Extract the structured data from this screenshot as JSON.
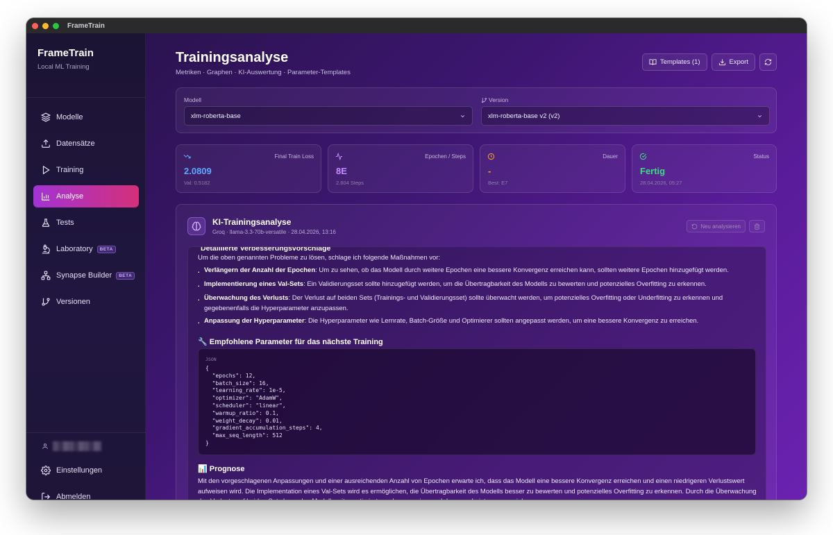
{
  "window": {
    "title": "FrameTrain"
  },
  "sidebar": {
    "brand": "FrameTrain",
    "subtitle": "Local ML Training",
    "items": [
      {
        "label": "Modelle"
      },
      {
        "label": "Datensätze"
      },
      {
        "label": "Training"
      },
      {
        "label": "Analyse",
        "active": true
      },
      {
        "label": "Tests"
      },
      {
        "label": "Laboratory",
        "badge": "BETA"
      },
      {
        "label": "Synapse Builder",
        "badge": "BETA"
      },
      {
        "label": "Versionen"
      }
    ],
    "settings_label": "Einstellungen",
    "logout_label": "Abmelden"
  },
  "header": {
    "title": "Trainingsanalyse",
    "subtitle": "Metriken · Graphen · KI-Auswertung · Parameter-Templates",
    "templates_label": "Templates (1)",
    "export_label": "Export"
  },
  "selectors": {
    "model_label": "Modell",
    "model_value": "xlm-roberta-base",
    "version_label": "Version",
    "version_value": "xlm-roberta-base v2 (v2)"
  },
  "stats": [
    {
      "label": "Final Train Loss",
      "value": "2.0809",
      "sub": "Val: 0.5182",
      "color": "#5fa8ff"
    },
    {
      "label": "Epochen / Steps",
      "value": "8E",
      "sub": "2.604 Steps",
      "color": "#c58cff"
    },
    {
      "label": "Dauer",
      "value": "-",
      "sub": "Best: E7",
      "color": "#f5a524"
    },
    {
      "label": "Status",
      "value": "Fertig",
      "sub": "28.04.2026, 05:27",
      "color": "#3ddc84"
    }
  ],
  "ai": {
    "title": "KI-Trainingsanalyse",
    "meta": "Groq · llama-3.3-70b-versatile · 28.04.2026, 13:16",
    "reanalyze_label": "Neu analysieren",
    "cut_heading": "Detaillierte Verbesserungsvorschläge",
    "intro": "Um die oben genannten Probleme zu lösen, schlage ich folgende Maßnahmen vor:",
    "bullets": [
      {
        "bold": "Verlängern der Anzahl der Epochen",
        "text": ": Um zu sehen, ob das Modell durch weitere Epochen eine bessere Konvergenz erreichen kann, sollten weitere Epochen hinzugefügt werden."
      },
      {
        "bold": "Implementierung eines Val-Sets",
        "text": ": Ein Validierungsset sollte hinzugefügt werden, um die Übertragbarkeit des Modells zu bewerten und potenzielles Overfitting zu erkennen."
      },
      {
        "bold": "Überwachung des Verlusts",
        "text": ": Der Verlust auf beiden Sets (Trainings- und Validierungsset) sollte überwacht werden, um potenzielles Overfitting oder Underfitting zu erkennen und gegebenenfalls die Hyperparameter anzupassen."
      },
      {
        "bold": "Anpassung der Hyperparameter",
        "text": ": Die Hyperparameter wie Lernrate, Batch-Größe und Optimierer sollten angepasst werden, um eine bessere Konvergenz zu erreichen."
      }
    ],
    "params_heading": "🔧 Empfohlene Parameter für das nächste Training",
    "code_label": "JSON",
    "code": "{\n  \"epochs\": 12,\n  \"batch_size\": 16,\n  \"learning_rate\": 1e-5,\n  \"optimizer\": \"AdamW\",\n  \"scheduler\": \"linear\",\n  \"warmup_ratio\": 0.1,\n  \"weight_decay\": 0.01,\n  \"gradient_accumulation_steps\": 4,\n  \"max_seq_length\": 512\n}",
    "forecast_heading": "📊 Prognose",
    "forecast_text": "Mit den vorgeschlagenen Anpassungen und einer ausreichenden Anzahl von Epochen erwarte ich, dass das Modell eine bessere Konvergenz erreichen und einen niedrigeren Verlustswert aufweisen wird. Die Implementation eines Val-Sets wird es ermöglichen, die Übertragbarkeit des Modells besser zu bewerten und potenzielles Overfitting zu erkennen. Durch die Überwachung des Verlusts auf beiden Sets kann das Modell weiter optimiert werden, um eine noch bessere Leistung zu erzielen."
  }
}
